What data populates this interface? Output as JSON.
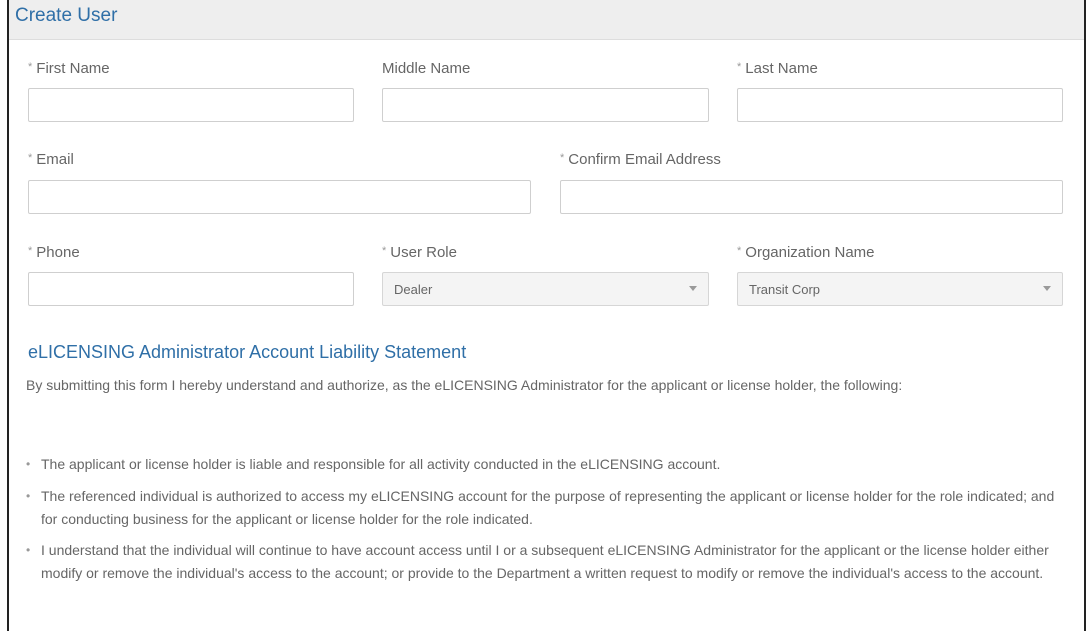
{
  "form": {
    "title": "Create User",
    "fields": {
      "first_name": {
        "label": "First Name",
        "required": "*",
        "value": ""
      },
      "middle_name": {
        "label": "Middle Name",
        "value": ""
      },
      "last_name": {
        "label": "Last Name",
        "required": "*",
        "value": ""
      },
      "email": {
        "label": "Email",
        "required": "*",
        "value": ""
      },
      "confirm_email": {
        "label": "Confirm Email Address",
        "required": "*",
        "value": ""
      },
      "phone": {
        "label": "Phone",
        "required": "*",
        "value": ""
      },
      "user_role": {
        "label": "User Role",
        "required": "*",
        "selected": "Dealer"
      },
      "organization": {
        "label": "Organization Name",
        "required": "*",
        "selected": "Transit Corp"
      }
    }
  },
  "statement": {
    "title": "eLICENSING Administrator Account Liability Statement",
    "intro": "By submitting this form I hereby understand and authorize, as the eLICENSING Administrator for the applicant or license holder, the following:",
    "bullets": [
      "The applicant or license holder is liable and responsible for all activity conducted in the eLICENSING account.",
      "The referenced individual is authorized to access my eLICENSING account for the purpose of representing the applicant or license holder for the role indicated; and for conducting business for the applicant or license holder for the role indicated.",
      "I understand that the individual will continue to have account access until I or a subsequent eLICENSING Administrator for the applicant or the license holder either modify or remove the individual's access to the account; or provide to the Department a written request to modify or remove the individual's access to the account."
    ],
    "bullet_symbol": "•"
  },
  "colors": {
    "accent": "#2f6fa7",
    "header_bg": "#eeeeee",
    "text": "#666666"
  },
  "icons": {
    "dropdown": "chevron-down-icon"
  }
}
